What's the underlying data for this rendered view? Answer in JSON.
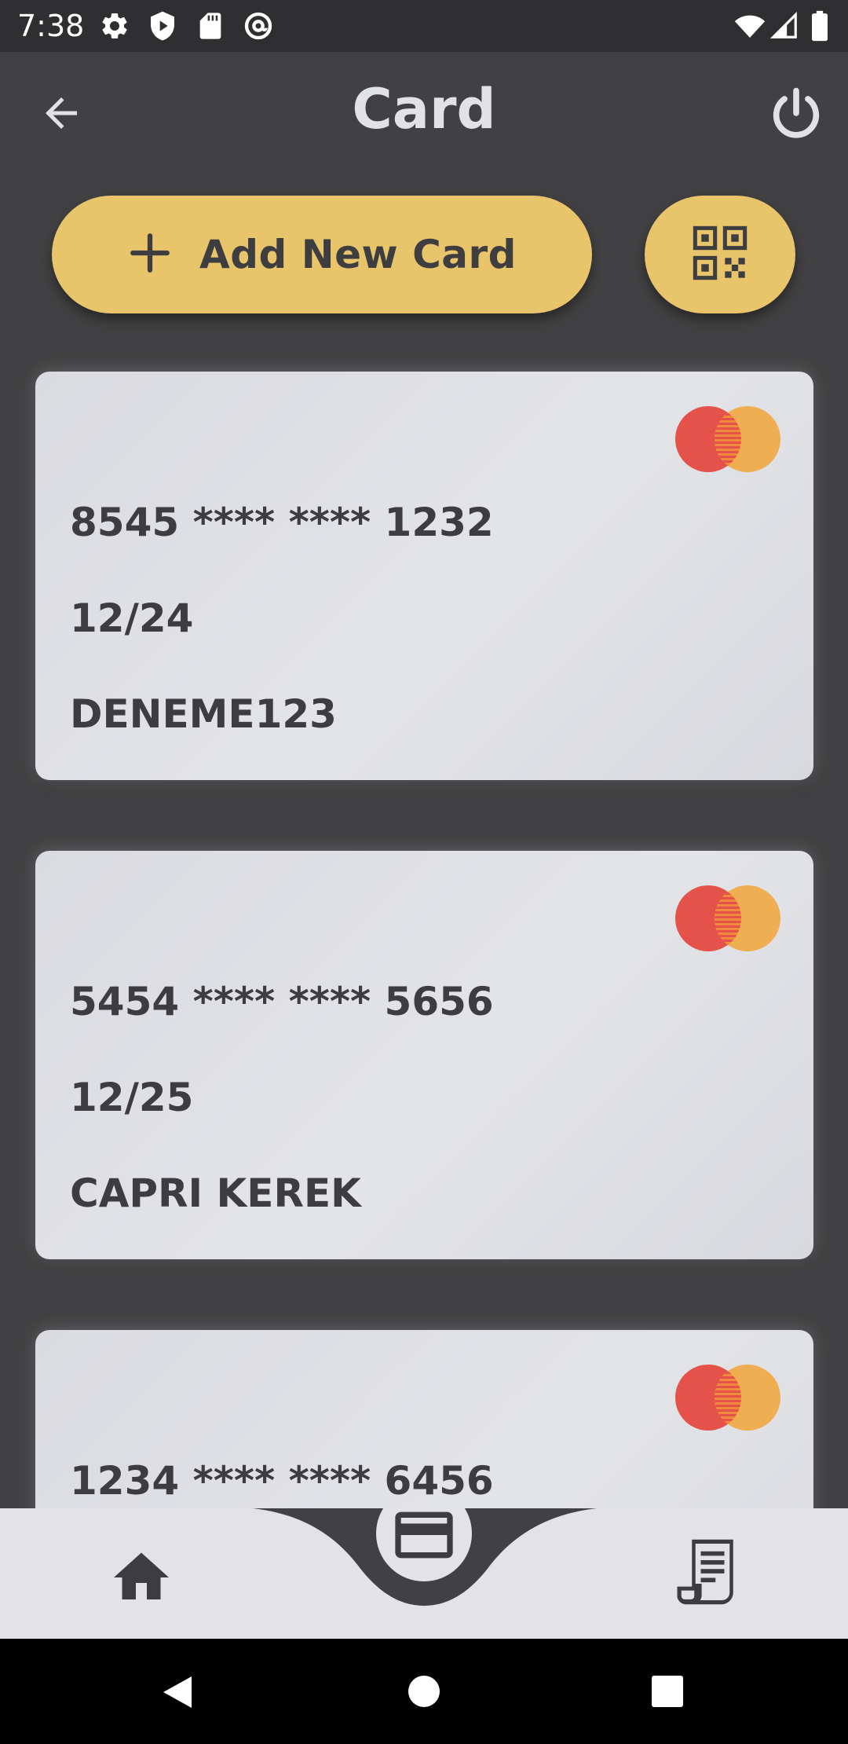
{
  "status_bar": {
    "time": "7:38",
    "left_icons": [
      "gear-icon",
      "shield-play-icon",
      "sd-card-icon",
      "at-sign-icon"
    ],
    "right_icons": [
      "wifi-icon",
      "signal-icon",
      "battery-icon"
    ]
  },
  "app_bar": {
    "title": "Card",
    "back_icon": "arrow-left-icon",
    "power_icon": "power-icon"
  },
  "actions": {
    "add_card_label": "Add New Card",
    "add_icon": "plus-icon",
    "qr_icon": "qr-code-icon"
  },
  "cards": [
    {
      "number": "8545 **** **** 1232",
      "expiry": "12/24",
      "holder": "DENEME123",
      "brand": "mastercard"
    },
    {
      "number": "5454 **** **** 5656",
      "expiry": "12/25",
      "holder": "CAPRI KEREK",
      "brand": "mastercard"
    },
    {
      "number": "1234 **** **** 6456",
      "expiry": "",
      "holder": "",
      "brand": "mastercard"
    }
  ],
  "bottom_nav": {
    "items": [
      "home-icon",
      "credit-card-icon",
      "receipt-icon"
    ],
    "active": "credit-card-icon"
  },
  "colors": {
    "background": "#414042",
    "accent": "#e8c46a",
    "card": "#dfe0e4",
    "text_dark": "#3d3d40",
    "nav_bg": "#e3e3e7",
    "mastercard_red": "#e5524a",
    "mastercard_orange": "#efae52"
  }
}
